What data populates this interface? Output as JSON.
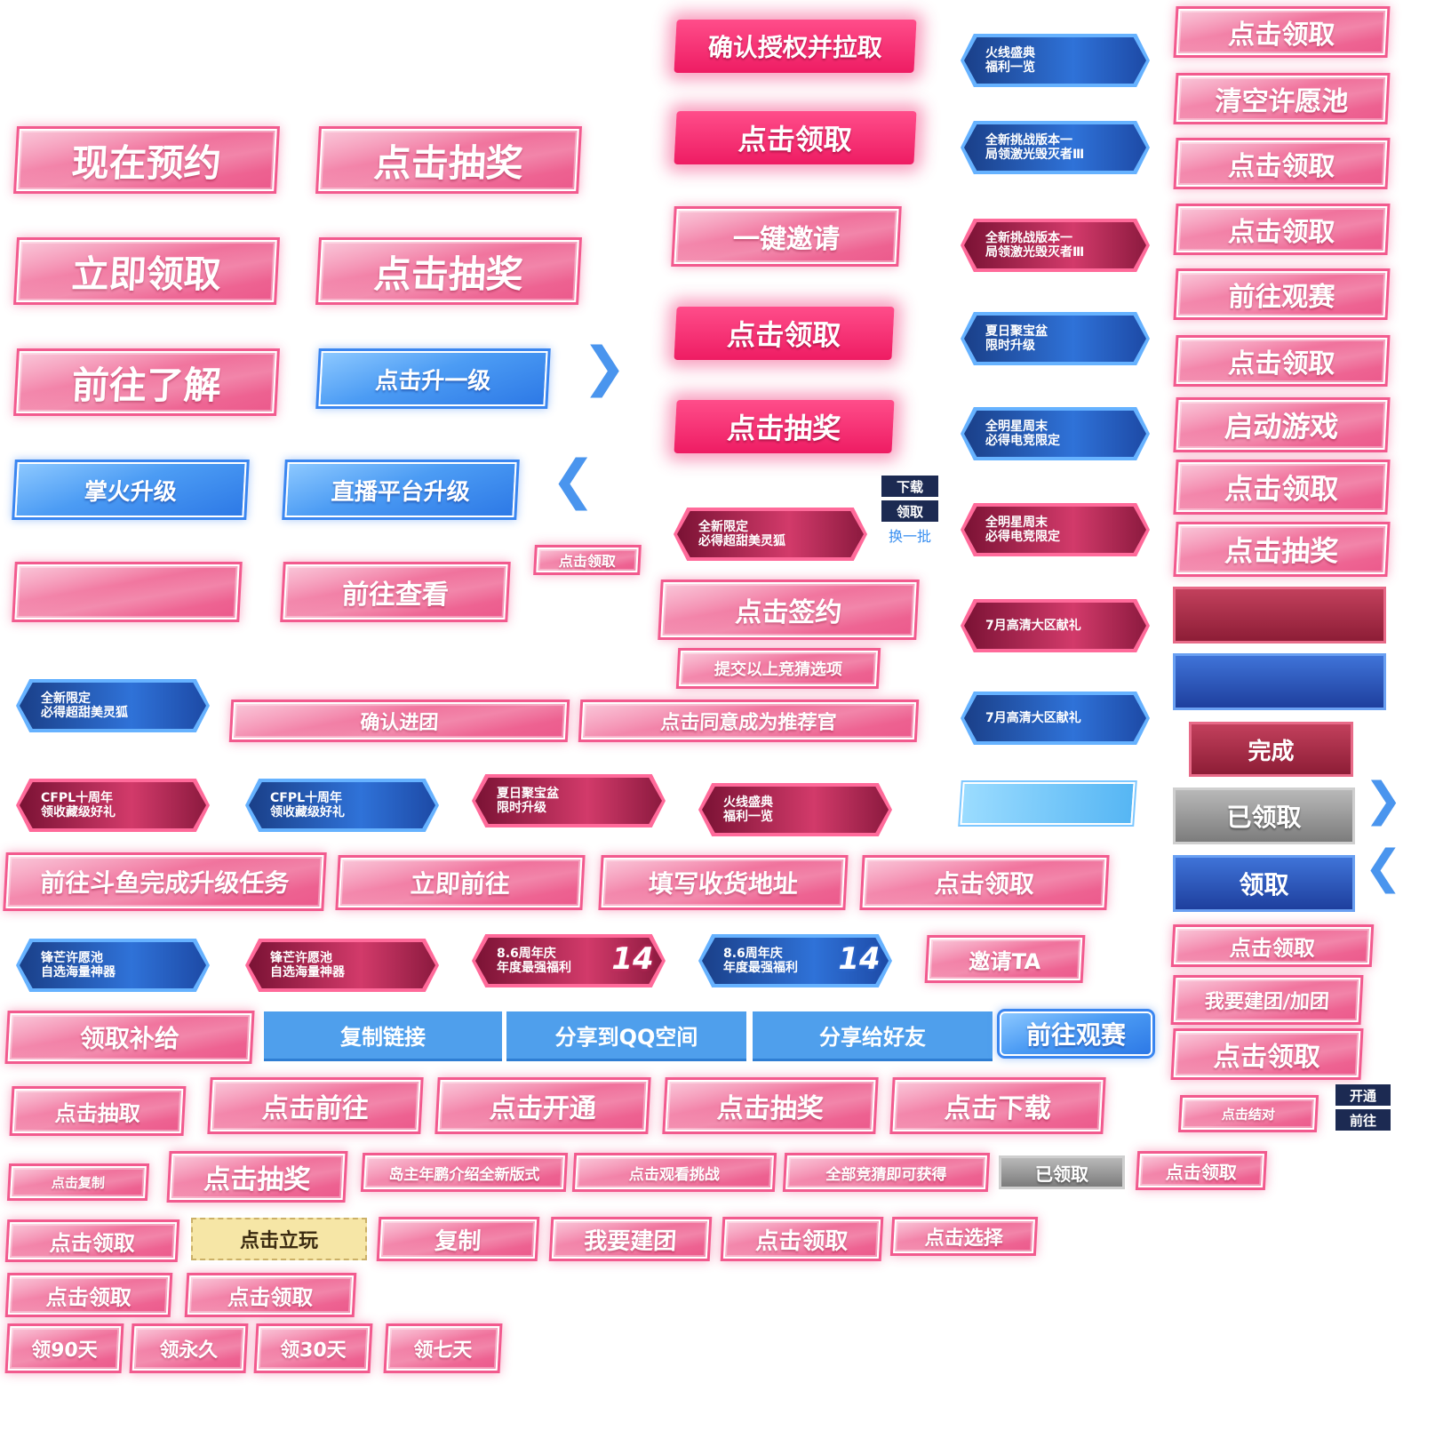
{
  "pink_large": [
    "现在预约",
    "点击抽奖",
    "立即领取",
    "点击抽奖",
    "前往了解"
  ],
  "blue_buttons": [
    "点击升一级",
    "掌火升级",
    "直播平台升级"
  ],
  "red_column": [
    "确认授权并拉取",
    "点击领取",
    "一键邀请",
    "点击领取",
    "点击抽奖"
  ],
  "right_column": [
    "点击领取",
    "清空许愿池",
    "点击领取",
    "点击领取",
    "前往观赛",
    "点击领取",
    "启动游戏",
    "点击领取",
    "点击抽奖"
  ],
  "mini_controls": {
    "download": "下载",
    "receive": "领取",
    "refresh": "换一批"
  },
  "small_claim": "点击领取",
  "row_misc": {
    "view": "前往查看",
    "sign": "点击签约",
    "submit": "提交以上竞猜选项",
    "confirm_group": "确认进团",
    "agree_recommend": "点击同意成为推荐官"
  },
  "badges_right": [
    "火线盛典\n福利一览",
    "全新挑战版本一\n局领激光毁灭者Ⅲ",
    "全新挑战版本一\n局领激光毁灭者Ⅲ",
    "夏日聚宝盆\n限时升级",
    "全明星周末\n必得电竞限定",
    "全明星周末\n必得电竞限定",
    "7月高清大区献礼",
    "7月高清大区献礼"
  ],
  "badges_row1": [
    "全新限定\n必得超甜美灵狐",
    "全新限定\n必得超甜美灵狐"
  ],
  "badges_row2": [
    "CFPL十周年\n领收藏级好礼",
    "CFPL十周年\n领收藏级好礼",
    "夏日聚宝盆\n限时升级",
    "火线盛典\n福利一览"
  ],
  "badges_row3": [
    "锋芒许愿池\n自选海量神器",
    "锋芒许愿池\n自选海量神器",
    "8.6周年庆\n年度最强福利",
    "8.6周年庆\n年度最强福利"
  ],
  "badge_14": "14",
  "state_buttons": {
    "done": "完成",
    "claimed": "已领取",
    "claim": "领取"
  },
  "row_a": [
    "前往斗鱼完成升级任务",
    "立即前往",
    "填写收货地址",
    "点击领取"
  ],
  "invite": "邀请TA",
  "right_lower": [
    "点击领取",
    "我要建团/加团",
    "点击领取"
  ],
  "share_row": {
    "supply": "领取补给",
    "copy_link": "复制链接",
    "share_qzone": "分享到QQ空间",
    "share_friend": "分享给好友",
    "watch": "前往观赛"
  },
  "row_b": [
    "点击抽取",
    "点击前往",
    "点击开通",
    "点击抽奖",
    "点击下载"
  ],
  "pair_button": "点击结对",
  "navy_buttons": [
    "开通",
    "前往"
  ],
  "row_c": [
    "点击复制",
    "点击抽奖",
    "岛主年鹏介绍全新版式",
    "点击观看挑战",
    "全部竞猜即可获得",
    "已领取",
    "点击领取"
  ],
  "row_d": [
    "点击领取",
    "点击立玩",
    "复制",
    "我要建团",
    "点击领取",
    "点击选择"
  ],
  "row_e": [
    "点击领取",
    "点击领取"
  ],
  "row_f": [
    "领90天",
    "领永久",
    "领30天",
    "领七天"
  ]
}
